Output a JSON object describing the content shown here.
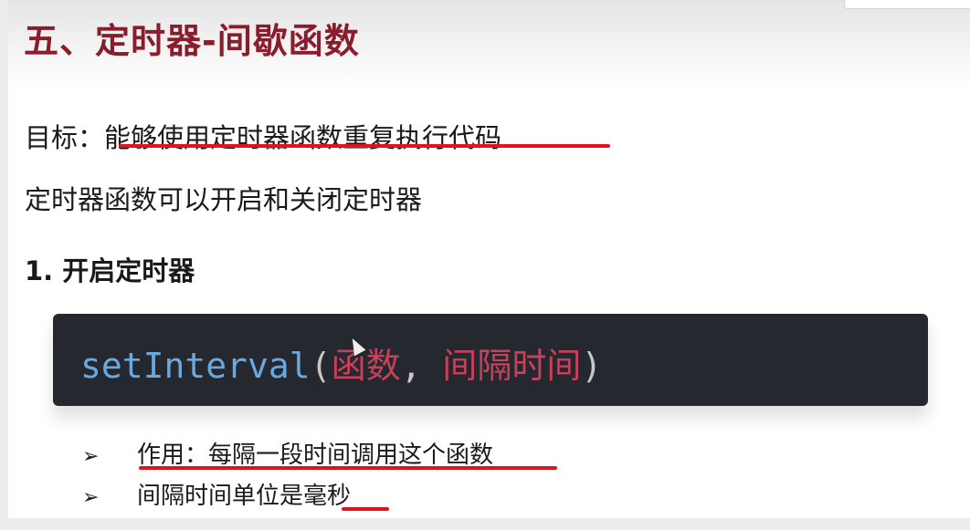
{
  "title": "五、定时器-间歇函数",
  "goal": {
    "label": "目标：",
    "text": "能够使用定时器函数重复执行代码"
  },
  "intro": "定时器函数可以开启和关闭定时器",
  "section": "1. 开启定时器",
  "code": {
    "fn": "setInterval",
    "open": "(",
    "arg1": "函数",
    "sep": ", ",
    "arg2": "间隔时间",
    "close": ")"
  },
  "bullets": [
    {
      "marker": "➢",
      "text": "作用：每隔一段时间调用这个函数"
    },
    {
      "marker": "➢",
      "text": "间隔时间单位是",
      "emph": "毫秒"
    }
  ],
  "colors": {
    "title": "#8a1c2c",
    "underline": "#e0141e",
    "code_bg": "#262830"
  }
}
